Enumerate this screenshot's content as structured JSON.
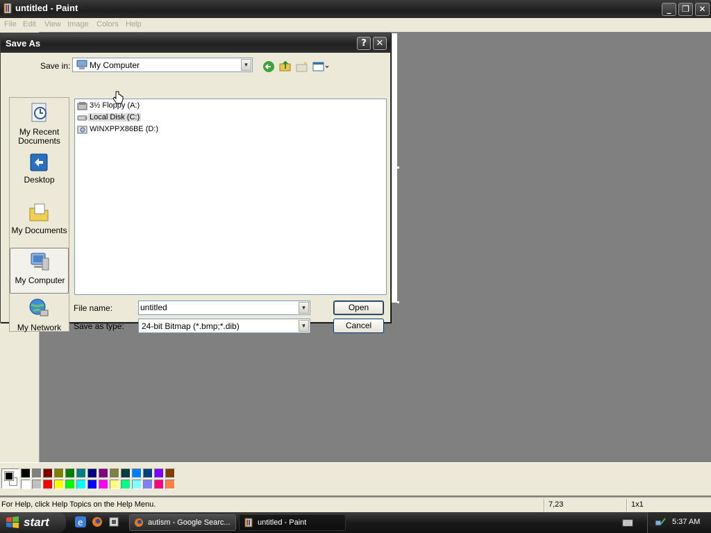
{
  "paint_window": {
    "title": "untitled - Paint",
    "buttons": {
      "minimize": "_",
      "restore": "❐",
      "close": "✕"
    },
    "menu": [
      "File",
      "Edit",
      "View",
      "Image",
      "Colors",
      "Help"
    ]
  },
  "save_dialog": {
    "title": "Save As",
    "help_glyph": "?",
    "close_glyph": "✕",
    "save_in_label": "Save in:",
    "save_in_value": "My Computer",
    "places": [
      "My Recent Documents",
      "Desktop",
      "My Documents",
      "My Computer",
      "My Network"
    ],
    "selected_place": "My Computer",
    "files": [
      "3½ Floppy (A:)",
      "Local Disk (C:)",
      "WINXPPX86BE (D:)"
    ],
    "hovered_file": "Local Disk (C:)",
    "file_name_label": "File name:",
    "file_name_value": "untitled",
    "save_as_type_label": "Save as type:",
    "save_as_type_value": "24-bit Bitmap (*.bmp;*.dib)",
    "open_button": "Open",
    "cancel_button": "Cancel"
  },
  "palette": {
    "foreground": "#000000",
    "background": "#ffffff",
    "top_row": [
      "#000000",
      "#808080",
      "#800000",
      "#808000",
      "#008000",
      "#008080",
      "#000080",
      "#800080",
      "#808040",
      "#004040",
      "#0080ff",
      "#004080",
      "#8000ff",
      "#804000"
    ],
    "bottom_row": [
      "#ffffff",
      "#c0c0c0",
      "#ff0000",
      "#ffff00",
      "#00ff00",
      "#00ffff",
      "#0000ff",
      "#ff00ff",
      "#ffff80",
      "#00ff80",
      "#80ffff",
      "#8080ff",
      "#ff0080",
      "#ff8040"
    ]
  },
  "status_bar": {
    "help_text": "For Help, click Help Topics on the Help Menu.",
    "coordinates": "7,23",
    "size": "1x1"
  },
  "taskbar": {
    "start_label": "start",
    "tasks": [
      {
        "label": "autism - Google Searc...",
        "icon": "firefox-icon",
        "active": false
      },
      {
        "label": "untitled - Paint",
        "icon": "paint-icon",
        "active": true
      }
    ],
    "clock": "5:37 AM"
  }
}
